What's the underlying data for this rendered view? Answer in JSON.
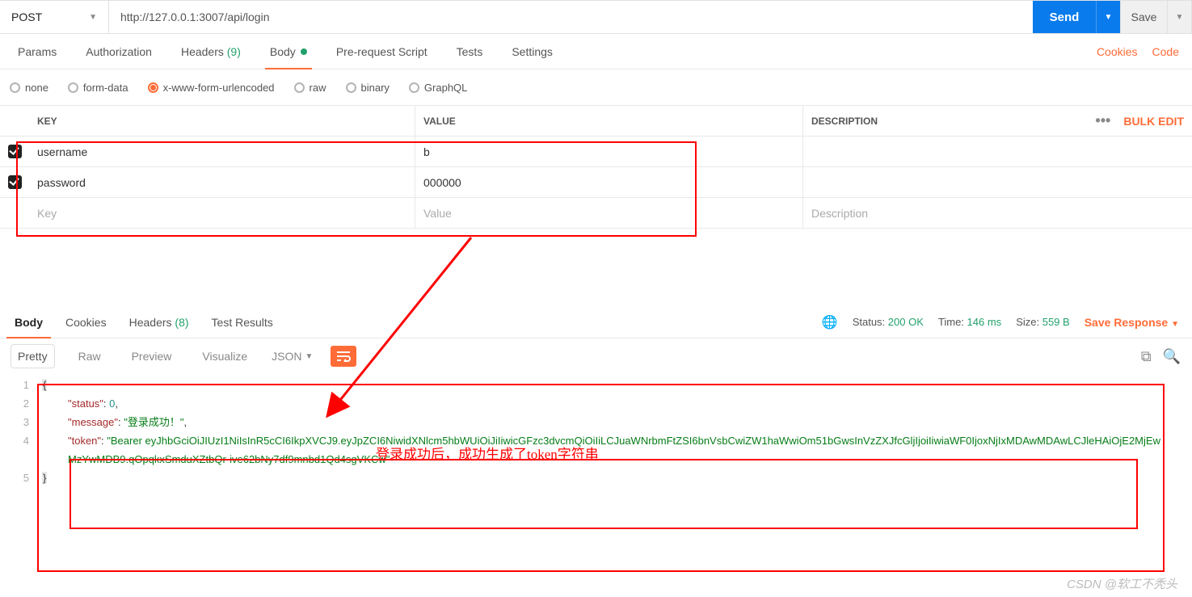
{
  "request": {
    "method": "POST",
    "url": "http://127.0.0.1:3007/api/login",
    "send_label": "Send",
    "save_label": "Save"
  },
  "req_tabs": {
    "params": "Params",
    "auth": "Authorization",
    "headers_label": "Headers",
    "headers_count": "(9)",
    "body": "Body",
    "prerequest": "Pre-request Script",
    "tests": "Tests",
    "settings": "Settings",
    "cookies_link": "Cookies",
    "code_link": "Code"
  },
  "body_types": {
    "none": "none",
    "formdata": "form-data",
    "urlencoded": "x-www-form-urlencoded",
    "raw": "raw",
    "binary": "binary",
    "graphql": "GraphQL",
    "selected": "urlencoded"
  },
  "kv": {
    "hdr_key": "Key",
    "hdr_val": "Value",
    "hdr_desc": "Description",
    "bulk_edit": "Bulk Edit",
    "rows": [
      {
        "key": "username",
        "value": "b"
      },
      {
        "key": "password",
        "value": "000000"
      }
    ],
    "ph_key": "Key",
    "ph_val": "Value",
    "ph_desc": "Description"
  },
  "resp_tabs": {
    "body": "Body",
    "cookies": "Cookies",
    "headers_label": "Headers",
    "headers_count": "(8)",
    "test_results": "Test Results"
  },
  "resp_meta": {
    "status_label": "Status:",
    "status_value": "200 OK",
    "time_label": "Time:",
    "time_value": "146 ms",
    "size_label": "Size:",
    "size_value": "559 B",
    "save_response": "Save Response"
  },
  "view": {
    "pretty": "Pretty",
    "raw": "Raw",
    "preview": "Preview",
    "visualize": "Visualize",
    "format": "JSON"
  },
  "json_body": {
    "l1": "{",
    "l2_key": "\"status\"",
    "l2_colon": ": ",
    "l2_val": "0",
    "l2_comma": ",",
    "l3_key": "\"message\"",
    "l3_colon": ": ",
    "l3_val": "\"登录成功！\"",
    "l3_comma": ",",
    "l4_key": "\"token\"",
    "l4_colon": ": ",
    "l4_val": "\"Bearer eyJhbGciOiJIUzI1NiIsInR5cCI6IkpXVCJ9.eyJpZCI6NiwidXNlcm5hbWUiOiJiIiwicGFzc3dvcmQiOiIiLCJuaWNrbmFtZSI6bnVsbCwiZW1haWwiOm51bGwsInVzZXJfcGljIjoiIiwiaWF0IjoxNjIxMDAwMDAwLCJleHAiOjE2MjEwMzYwMDB9.qOpqkxSmduXZtbQr-ive62bNy7df9mnbd1Qd4sgVKCw\"",
    "l5": "}"
  },
  "annotation_text": "登录成功后，成功生成了token字符串",
  "watermark": "CSDN @软工不秃头"
}
